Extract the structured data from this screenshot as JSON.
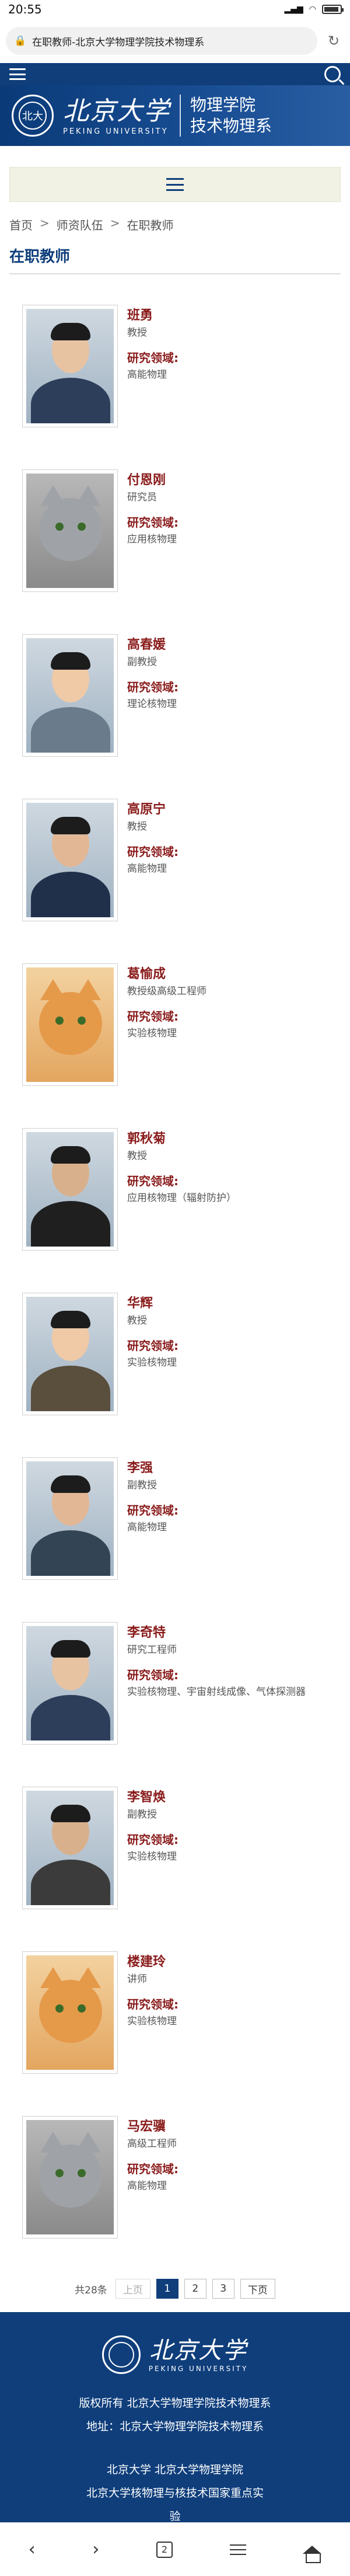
{
  "status": {
    "time": "20:55",
    "signal": "4G",
    "wifi": "wifi",
    "battery_level": 0.8
  },
  "browser": {
    "url_title": "在职教师-北京大学物理学院技术物理系",
    "refresh_icon": "refresh-icon"
  },
  "site": {
    "logo_cn": "北京大学",
    "logo_en": "PEKING UNIVERSITY",
    "dept_line1": "物理学院",
    "dept_line2": "技术物理系",
    "seal_text": "北大"
  },
  "breadcrumb": {
    "home": "首页",
    "sep": ">",
    "level2": "师资队伍",
    "level3": "在职教师"
  },
  "section_title": "在职教师",
  "research_label": "研究领域:",
  "teachers": [
    {
      "name": "班勇",
      "title": "教授",
      "field": "高能物理",
      "photo": "person"
    },
    {
      "name": "付恩刚",
      "title": "研究员",
      "field": "应用核物理",
      "photo": "cat"
    },
    {
      "name": "高春媛",
      "title": "副教授",
      "field": "理论核物理",
      "photo": "person"
    },
    {
      "name": "高原宁",
      "title": "教授",
      "field": "高能物理",
      "photo": "person"
    },
    {
      "name": "葛愉成",
      "title": "教授级高级工程师",
      "field": "实验核物理",
      "photo": "cat"
    },
    {
      "name": "郭秋菊",
      "title": "教授",
      "field": "应用核物理（辐射防护）",
      "photo": "person"
    },
    {
      "name": "华辉",
      "title": "教授",
      "field": "实验核物理",
      "photo": "person"
    },
    {
      "name": "李强",
      "title": "副教授",
      "field": "高能物理",
      "photo": "person"
    },
    {
      "name": "李奇特",
      "title": "研究工程师",
      "field": "实验核物理、宇宙射线成像、气体探测器",
      "photo": "person"
    },
    {
      "name": "李智焕",
      "title": "副教授",
      "field": "实验核物理",
      "photo": "person"
    },
    {
      "name": "楼建玲",
      "title": "讲师",
      "field": "实验核物理",
      "photo": "cat"
    },
    {
      "name": "马宏骥",
      "title": "高级工程师",
      "field": "高能物理",
      "photo": "cat"
    }
  ],
  "pager": {
    "total": "共28条",
    "prev": "上页",
    "pages": [
      "1",
      "2",
      "3"
    ],
    "current": "1",
    "next": "下页"
  },
  "footer": {
    "logo_cn": "北京大学",
    "logo_en": "PEKING UNIVERSITY",
    "copyright": "版权所有 北京大学物理学院技术物理系",
    "address": "地址：北京大学物理学院技术物理系",
    "links_line1": "北京大学   北京大学物理学院",
    "links_line2": "北京大学核物理与核技术国家重点实",
    "links_line3": "验"
  },
  "bottomnav": {
    "tabs_count": "2"
  },
  "colors": {
    "brand": "#0f3e7b",
    "name_red": "#8a1c1c"
  }
}
